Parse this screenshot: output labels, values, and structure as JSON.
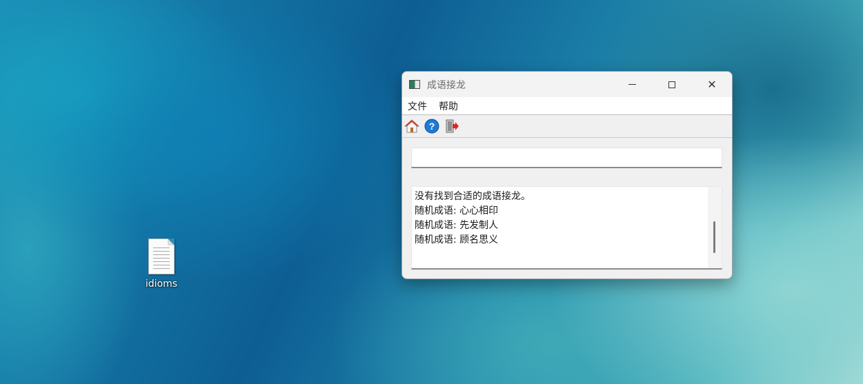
{
  "desktop": {
    "icons": [
      {
        "label": "idioms",
        "icon": "text-file-icon"
      }
    ]
  },
  "window": {
    "title": "成语接龙",
    "app_icon": "app-window-icon",
    "controls": {
      "minimize": "minimize-icon",
      "maximize": "maximize-icon",
      "close": "close-icon",
      "close_glyph": "✕"
    },
    "menu": [
      {
        "label": "文件"
      },
      {
        "label": "帮助"
      }
    ],
    "toolbar": [
      {
        "name": "home-icon",
        "accent": "#d23a2a"
      },
      {
        "name": "help-icon",
        "accent": "#1e7ad6"
      },
      {
        "name": "exit-icon",
        "accent": "#d42a2a"
      }
    ],
    "input": {
      "value": "",
      "placeholder": ""
    },
    "output_lines": [
      "没有找到合适的成语接龙。",
      "随机成语: 心心相印",
      "随机成语: 先发制人",
      "随机成语: 顾名思义"
    ]
  }
}
